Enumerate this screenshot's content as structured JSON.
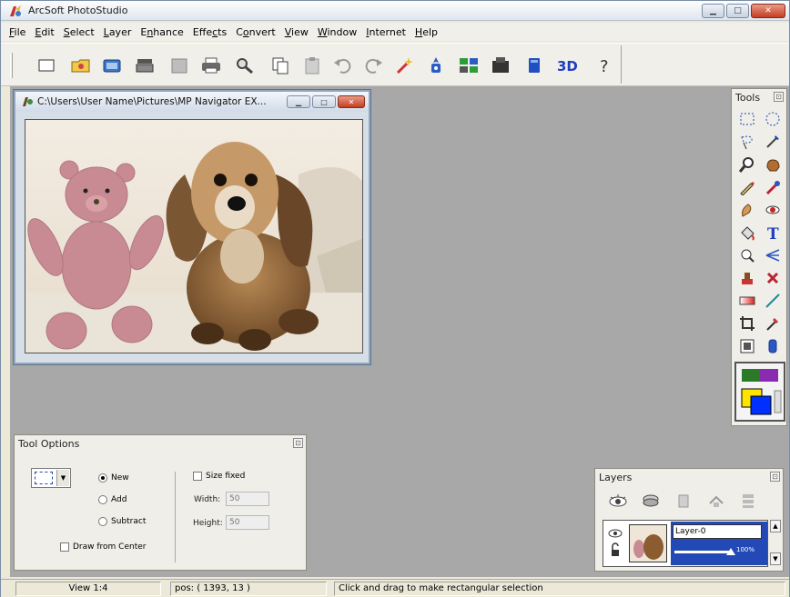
{
  "app": {
    "title": "ArcSoft PhotoStudio"
  },
  "menu": [
    {
      "u": "F",
      "rest": "ile"
    },
    {
      "u": "E",
      "rest": "dit"
    },
    {
      "u": "S",
      "rest": "elect"
    },
    {
      "u": "L",
      "rest": "ayer"
    },
    {
      "pre": "E",
      "u": "n",
      "rest": "hance"
    },
    {
      "pre": "Effe",
      "u": "c",
      "rest": "ts"
    },
    {
      "pre": "C",
      "u": "o",
      "rest": "nvert"
    },
    {
      "u": "V",
      "rest": "iew"
    },
    {
      "u": "W",
      "rest": "indow"
    },
    {
      "u": "I",
      "rest": "nternet"
    },
    {
      "u": "H",
      "rest": "elp"
    }
  ],
  "toolbar_icons": [
    "new-icon",
    "open-icon",
    "acquire-icon",
    "print-preview-icon",
    "save-icon",
    "print-icon",
    "find-icon",
    "copy-icon",
    "paste-icon",
    "undo-icon",
    "redo-icon",
    "magic-wand-icon",
    "settings-icon",
    "arrange-icon",
    "film-icon",
    "book-icon",
    "3d-icon",
    "help-icon"
  ],
  "image_window": {
    "path": "C:\\Users\\User Name\\Pictures\\MP Navigator EX..."
  },
  "tools_panel": {
    "title": "Tools"
  },
  "tool_options": {
    "title": "Tool Options",
    "mode_new": "New",
    "mode_add": "Add",
    "mode_subtract": "Subtract",
    "draw_from_center": "Draw from Center",
    "size_fixed": "Size fixed",
    "width_label": "Width:",
    "width_value": "50",
    "height_label": "Height:",
    "height_value": "50",
    "selected_mode": "New"
  },
  "layers_panel": {
    "title": "Layers",
    "layer_name": "Layer-0",
    "opacity": "100%",
    "opacity_fraction": 1.0
  },
  "status": {
    "view": "View 1:4",
    "pos": "pos: ( 1393, 13 )",
    "hint": "Click and drag to make rectangular selection"
  },
  "colors": {
    "accent": "#2349b6",
    "workspace": "#a8a8a8",
    "close": "#c43d22"
  }
}
